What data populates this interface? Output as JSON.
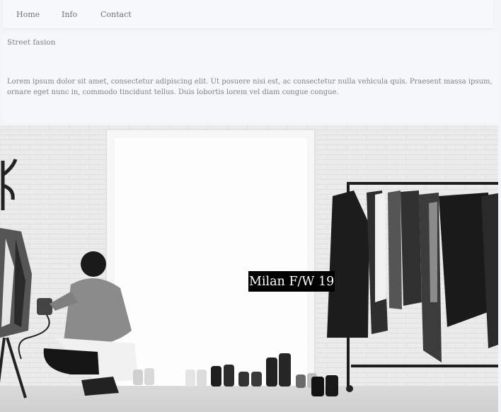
{
  "nav": {
    "items": [
      {
        "label": "Home"
      },
      {
        "label": "Info"
      },
      {
        "label": "Contact"
      }
    ]
  },
  "intro": {
    "subtitle": "Street fasion",
    "paragraph": "Lorem ipsum dolor sit amet, consectetur adipiscing elit. Ut posuere nisi est, ac consectetur nulla vehicula quis. Praesent massa ipsum, ornare eget nunc in, commodo tincidunt tellus. Duis lobortis lorem vel diam congue congue."
  },
  "hero": {
    "caption": "Milan F/W 19",
    "image_style": "black-and-white"
  },
  "colors": {
    "page_background": "#f4f5f7",
    "text": "#7a7f86",
    "caption_background": "#000000",
    "caption_text": "#ffffff"
  }
}
